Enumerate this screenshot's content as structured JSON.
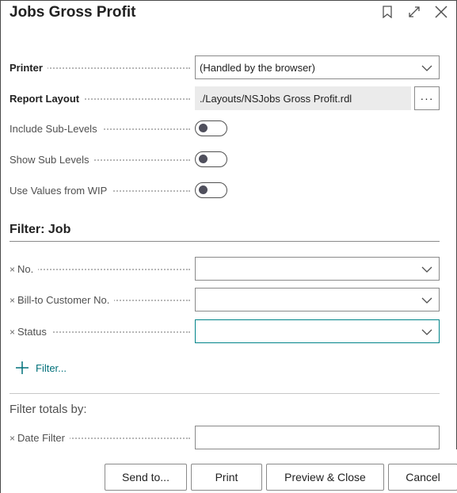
{
  "dialog": {
    "title": "Jobs Gross Profit",
    "icons": [
      "bookmark-icon",
      "expand-icon",
      "close-icon"
    ]
  },
  "options": {
    "printer_label": "Printer",
    "printer_value": "(Handled by the browser)",
    "report_layout_label": "Report Layout",
    "report_layout_value": "./Layouts/NSJobs Gross Profit.rdl",
    "report_layout_button": "···",
    "include_sub_levels_label": "Include Sub-Levels",
    "include_sub_levels_on": false,
    "show_sub_levels_label": "Show Sub Levels",
    "show_sub_levels_on": false,
    "use_values_wip_label": "Use Values from WIP",
    "use_values_wip_on": false
  },
  "filter_job": {
    "title": "Filter: Job",
    "remove_glyph": "×",
    "fields": [
      {
        "label": "No.",
        "value": ""
      },
      {
        "label": "Bill-to Customer No.",
        "value": ""
      },
      {
        "label": "Status",
        "value": ""
      }
    ],
    "add_filter_label": "Filter..."
  },
  "filter_totals": {
    "title": "Filter totals by:",
    "fields": [
      {
        "label": "Date Filter",
        "value": ""
      }
    ]
  },
  "actions": {
    "send_to": "Send to...",
    "print": "Print",
    "preview_close": "Preview & Close",
    "cancel": "Cancel"
  },
  "colors": {
    "accent": "#008489",
    "link": "#00707a",
    "toggle_knob": "#4f4f5c"
  }
}
